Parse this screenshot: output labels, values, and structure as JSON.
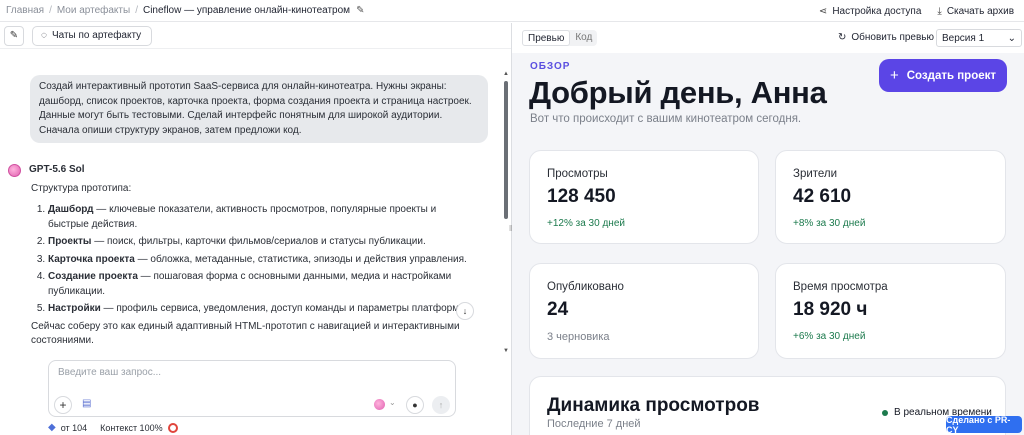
{
  "breadcrumbs": {
    "home": "Главная",
    "artifacts": "Мои артефакты",
    "current": "Cineflow — управление онлайн-кинотеатром"
  },
  "header_actions": {
    "access": "Настройка доступа",
    "download": "Скачать архив"
  },
  "left_toolbar": {
    "chats_button": "Чаты по артефакту"
  },
  "chat": {
    "user_message": "Создай интерактивный прототип SaaS-сервиса для онлайн-кинотеатра. Нужны экраны: дашборд, список проектов, карточка проекта, форма создания проекта и страница настроек. Данные могут быть тестовыми. Сделай интерфейс понятным для широкой аудитории. Сначала опиши структуру экранов, затем предложи код.",
    "bot_name": "GPT-5.6 Sol",
    "bot_intro": "Структура прототипа:",
    "bot_items": [
      {
        "title": "Дашборд",
        "text": " — ключевые показатели, активность просмотров, популярные проекты и быстрые действия."
      },
      {
        "title": "Проекты",
        "text": " — поиск, фильтры, карточки фильмов/сериалов и статусы публикации."
      },
      {
        "title": "Карточка проекта",
        "text": " — обложка, метаданные, статистика, эпизоды и действия управления."
      },
      {
        "title": "Создание проекта",
        "text": " — пошаговая форма с основными данными, медиа и настройками публикации."
      },
      {
        "title": "Настройки",
        "text": " — профиль сервиса, уведомления, доступ команды и параметры платформы."
      }
    ],
    "bot_outro": "Сейчас соберу это как единый адаптивный HTML-прототип с навигацией и интерактивными состояниями."
  },
  "composer": {
    "placeholder": "Введите ваш запрос..."
  },
  "meta": {
    "cost": "от 104",
    "context": "Контекст 100%"
  },
  "right_toolbar": {
    "tab_preview": "Превью",
    "tab_code": "Код",
    "refresh": "Обновить превью",
    "version": "Версия 1"
  },
  "preview": {
    "eyebrow": "ОБЗОР",
    "greeting": "Добрый день, Анна",
    "subtitle": "Вот что происходит с вашим кинотеатром сегодня.",
    "create_button": "Создать проект",
    "cards": [
      {
        "label": "Просмотры",
        "value": "128 450",
        "delta": "+12% за 30 дней"
      },
      {
        "label": "Зрители",
        "value": "42 610",
        "delta": "+8% за 30 дней"
      },
      {
        "label": "Опубликовано",
        "value": "24",
        "note": "3 черновика"
      },
      {
        "label": "Время просмотра",
        "value": "18 920 ч",
        "delta": "+6% за 30 дней"
      }
    ],
    "chart_title": "Динамика просмотров",
    "chart_sub": "Последние 7 дней",
    "live_label": "В реальном времени"
  },
  "badge": "Сделано с PR-CY",
  "colors": {
    "accent": "#5b45e6",
    "positive": "#1c7a4d",
    "badge": "#2f6ff0"
  }
}
